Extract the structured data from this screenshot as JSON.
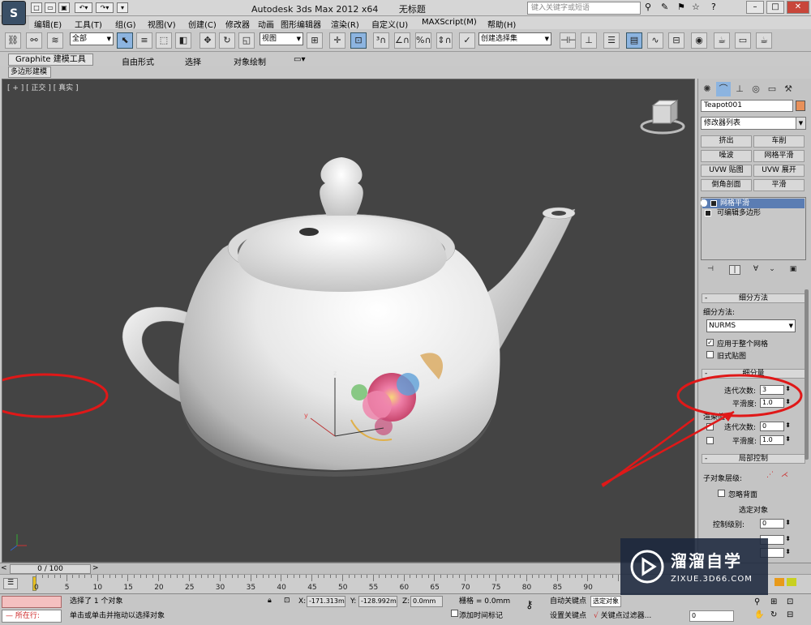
{
  "titlebar": {
    "app_title": "Autodesk 3ds Max  2012 x64",
    "file_name": "无标题",
    "search_placeholder": "键入关键字或短语",
    "logo": "S"
  },
  "menubar": {
    "items": [
      "编辑(E)",
      "工具(T)",
      "组(G)",
      "视图(V)",
      "创建(C)",
      "修改器",
      "动画",
      "图形编辑器",
      "渲染(R)",
      "自定义(U)",
      "MAXScript(M)",
      "帮助(H)"
    ]
  },
  "toolbar": {
    "selection_filter": "全部",
    "reference_coord": "视图",
    "named_selection": "创建选择集"
  },
  "ribbon": {
    "tabs": [
      "Graphite 建模工具",
      "自由形式",
      "选择",
      "对象绘制"
    ],
    "active_subtab": "多边形建模"
  },
  "viewport": {
    "label": "[ + ] [ 正交 ] [ 真实 ]",
    "axis_z": "z",
    "axis_y": "y"
  },
  "command_panel": {
    "object_name": "Teapot001",
    "object_color": "#e8905a",
    "modifier_list": "修改器列表",
    "modifier_buttons": [
      "挤出",
      "车削",
      "噪波",
      "网格平滑",
      "UVW 贴图",
      "UVW 展开",
      "倒角剖面",
      "平滑"
    ],
    "stack": [
      {
        "label": "网格平滑",
        "selected": true
      },
      {
        "label": "可编辑多边形",
        "selected": false
      }
    ],
    "subdivision_method": {
      "title": "细分方法",
      "method_label": "细分方法:",
      "method_value": "NURMS",
      "apply_whole_mesh": "应用于整个网格",
      "apply_checked": true,
      "old_style_mapping": "旧式贴图"
    },
    "subdivision_amount": {
      "title": "细分量",
      "iterations_label": "迭代次数:",
      "iterations_value": "3",
      "smoothness_label": "平滑度:",
      "smoothness_value": "1.0",
      "render_values": "渲染值:",
      "render_iterations_label": "迭代次数:",
      "render_iterations_value": "0",
      "render_smoothness_label": "平滑度:",
      "render_smoothness_value": "1.0"
    },
    "local_control": {
      "title": "局部控制",
      "subobject_level": "子对象层级:",
      "ignore_backfacing": "忽略背面",
      "select_object": "选定对象",
      "control_level_label": "控制级别:",
      "control_level_value": "0"
    }
  },
  "timeline": {
    "frame_display": "0 / 100",
    "ticks": [
      "0",
      "5",
      "10",
      "15",
      "20",
      "25",
      "30",
      "35",
      "40",
      "45",
      "50",
      "55",
      "60",
      "65",
      "70",
      "75",
      "80",
      "85",
      "90"
    ]
  },
  "statusbar": {
    "mode": "所在行:",
    "selection_status": "选择了 1 个对象",
    "prompt": "单击或单击并拖动以选择对象",
    "x_label": "X:",
    "x_value": "-171.313m",
    "y_label": "Y:",
    "y_value": "-128.992m",
    "z_label": "Z:",
    "z_value": "0.0mm",
    "grid": "栅格 = 0.0mm",
    "auto_key": "自动关键点",
    "set_key": "设置关键点",
    "selected_obj": "选定对象",
    "key_filters": "关键点过滤器...",
    "add_time_tag": "添加时间标记",
    "frame_field": "0"
  },
  "watermark": {
    "title": "溜溜自学",
    "subtitle": "ZIXUE.3D66.COM"
  }
}
